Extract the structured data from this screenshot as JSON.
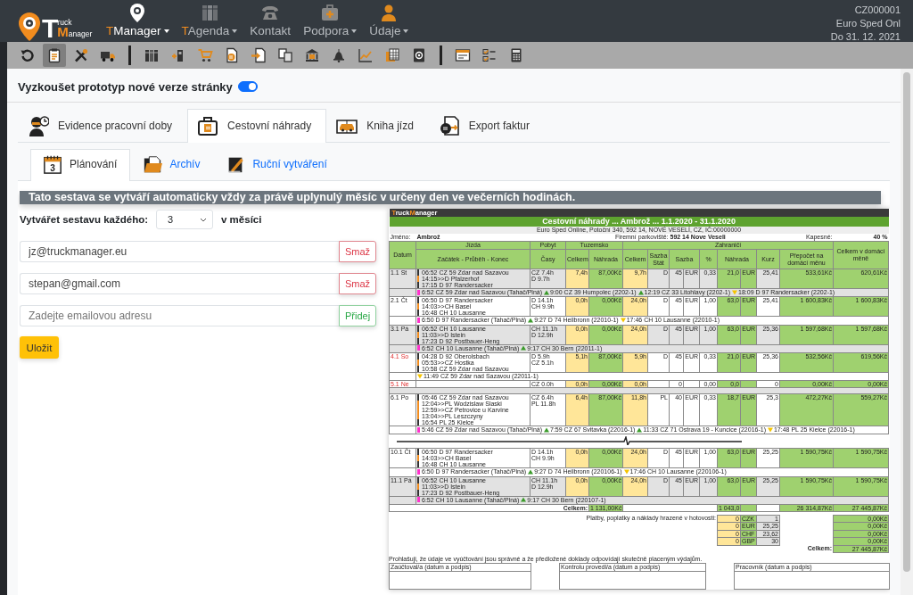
{
  "logo": {
    "big1": "T",
    "small1": "ruck",
    "big2": "M",
    "small2": "anager"
  },
  "nav": [
    {
      "label": "TManager",
      "kind": "brand",
      "selected": true,
      "dropdown": true
    },
    {
      "label": "TAgenda",
      "kind": "brand",
      "selected": false,
      "dropdown": true
    },
    {
      "label": "Kontakt",
      "kind": "plain",
      "selected": false,
      "dropdown": false
    },
    {
      "label": "Podpora",
      "kind": "plain",
      "selected": false,
      "dropdown": true
    },
    {
      "label": "Údaje",
      "kind": "plain",
      "selected": false,
      "dropdown": true
    }
  ],
  "account": [
    "CZ000001",
    "Euro Sped Onl",
    "Do 31. 12. 2021"
  ],
  "toolbar": {
    "groups": [
      [
        {
          "selected": false
        },
        {
          "selected": true
        },
        {
          "selected": false
        },
        {
          "selected": false
        }
      ],
      [
        {
          "selected": false
        },
        {
          "selected": false
        },
        {
          "selected": false
        },
        {
          "selected": false
        },
        {
          "selected": false
        },
        {
          "selected": false
        },
        {
          "selected": false
        },
        {
          "selected": false
        },
        {
          "selected": false
        },
        {
          "selected": false
        },
        {
          "selected": false
        }
      ],
      [
        {
          "selected": false
        },
        {
          "selected": false
        },
        {
          "selected": false
        }
      ]
    ]
  },
  "toggle": {
    "label": "Vyzkoušet prototyp nové verze stránky",
    "on": true
  },
  "tabs": [
    {
      "label": "Evidence pracovní doby",
      "selected": false
    },
    {
      "label": "Cestovní náhrady",
      "selected": true
    },
    {
      "label": "Kniha jízd",
      "selected": false
    },
    {
      "label": "Export faktur",
      "selected": false
    }
  ],
  "subtabs": [
    {
      "label": "Plánování",
      "selected": true,
      "icon_text": "3"
    },
    {
      "label": "Archív",
      "selected": false
    },
    {
      "label": "Ruční vytváření",
      "selected": false
    }
  ],
  "banner": "Tato sestava se vytváří automaticky vždy za právě uplynulý měsíc v určeny den ve večerních hodinách.",
  "schedule": {
    "label": "Vytvářet sestavu každého:",
    "value": "3",
    "suffix": "v měsíci"
  },
  "emails": [
    {
      "value": "jz@truckmanager.eu",
      "button": "Smaž",
      "kind": "delete"
    },
    {
      "value": "stepan@gmail.com",
      "button": "Smaž",
      "kind": "delete"
    },
    {
      "placeholder": "Zadejte emailovou adresu",
      "button": "Přidej",
      "kind": "add"
    }
  ],
  "save_button": "Uložit",
  "report": {
    "brand": [
      "Truck",
      "Manager"
    ],
    "title": "Cestovní náhrady ... Ambrož ... 1.1.2020 - 31.1.2020",
    "address": "Euro Sped Online, Potoční 340, 592 14, NOVÉ VESELÍ, CZ, IČ:00000000",
    "name_label": "Jméno:",
    "name": "Ambrož",
    "parking_label": "Firemní parkoviště:",
    "parking": "592 14 Nove Veseli",
    "pocket_label": "Kapesné:",
    "pocket": "40",
    "pocket_unit": "%",
    "header_top": [
      "Datum",
      "Jízda",
      "Pobyt",
      "Tuzemsko",
      "Zahraničí",
      "Celkem v domácí měně"
    ],
    "header_sub": [
      "Začátek - Průběh - Konec",
      "Časy",
      "Celkem",
      "Náhrada",
      "Celkem",
      "Sazba Stát",
      "Sazba",
      "%",
      "Náhrada",
      "Kurz",
      "Přepočet na domácí měnu"
    ],
    "rows": [
      {
        "date": "1.1 St",
        "weekend": false,
        "shaded": true,
        "route": [
          "06:52 CZ 59 Zdar nad Sazavou",
          "14:15>>D Pfalzerhof",
          "17:15 D 97 Randersacker"
        ],
        "stay": [
          "CZ 7.4h",
          "D 9.7h"
        ],
        "cells": [
          "7,4h",
          "87,00Kč",
          "9,7h",
          "D",
          "45",
          "EUR",
          "0,33",
          "21,0",
          "EUR",
          "25,41",
          "533,61Kč",
          "620,61Kč"
        ],
        "detail": [
          {
            "kind": "start",
            "text": "6:52 CZ 59 Zdar nad Sazavou (Tahač/Plná)"
          },
          {
            "kind": "load",
            "text": "9:00 CZ 39 Humpolec (2202-1)"
          },
          {
            "kind": "load",
            "text": "12:19 CZ 33 Litohlavy (2202-1)"
          },
          {
            "kind": "unload",
            "text": "18:09 D 97 Randersacker (2202-1)"
          }
        ]
      },
      {
        "date": "2.1 Čt",
        "weekend": false,
        "shaded": false,
        "route": [
          "06:50 D 97 Randersacker",
          "14:03>>CH Basel",
          "16:48 CH 10 Lausanne"
        ],
        "stay": [
          "D 14.1h",
          "CH 9.9h"
        ],
        "cells": [
          "0,0h",
          "0,00Kč",
          "24,0h",
          "D",
          "45",
          "EUR",
          "1,00",
          "63,0",
          "EUR",
          "25,41",
          "1 600,83Kč",
          "1 600,83Kč"
        ],
        "detail": [
          {
            "kind": "start",
            "text": "6:50 D 97 Randersacker (Tahač/Plná)"
          },
          {
            "kind": "load",
            "text": "9:27 D 74 Heilbronn (22010-1)"
          },
          {
            "kind": "unload",
            "text": "17:46 CH 10 Lausanne (22010-1)"
          }
        ]
      },
      {
        "date": "3.1 Pá",
        "weekend": false,
        "shaded": true,
        "route": [
          "06:52 CH 10 Lausanne",
          "11:03>>D Istein",
          "17:23 D 92 Postbauer-Heng"
        ],
        "stay": [
          "CH 11.1h",
          "D 12.9h"
        ],
        "cells": [
          "0,0h",
          "0,00Kč",
          "24,0h",
          "D",
          "45",
          "EUR",
          "1,00",
          "63,0",
          "EUR",
          "25,36",
          "1 597,68Kč",
          "1 597,68Kč"
        ],
        "detail": [
          {
            "kind": "start",
            "text": "6:52 CH 10 Lausanne (Tahač/Plná)"
          },
          {
            "kind": "load",
            "text": "9:17 CH 30 Bern (22011-1)"
          }
        ]
      },
      {
        "date": "4.1 So",
        "weekend": true,
        "shaded": false,
        "route": [
          "04:28 D 92 Oberolsbach",
          "05:53>>CZ Hostka",
          "10:58 CZ 59 Zdar nad Sazavou"
        ],
        "stay": [
          "D 5.9h",
          "CZ 5.1h"
        ],
        "cells": [
          "5,1h",
          "87,00Kč",
          "5,9h",
          "D",
          "45",
          "EUR",
          "0,33",
          "21,0",
          "EUR",
          "25,36",
          "532,56Kč",
          "619,56Kč"
        ],
        "detail": [
          {
            "kind": "unload",
            "text": "11:49 CZ 59 Zdar nad Sazavou (22011-1)"
          }
        ]
      },
      {
        "date": "5.1 Ne",
        "weekend": true,
        "shaded": false,
        "route": [],
        "stay": [
          "CZ 0.0h"
        ],
        "cells": [
          "0,0h",
          "0,00Kč",
          "0,0h",
          "",
          "0",
          "",
          "0,00",
          "0,0",
          "",
          "0",
          "0,00Kč",
          "0,00Kč"
        ]
      },
      {
        "date": "6.1 Po",
        "weekend": false,
        "shaded": false,
        "route": [
          "05:46 CZ 59 Zdar nad Sazavou",
          "12:04>>PL Wodzislaw Slaski",
          "12:59>>CZ Petrovice u Karvine",
          "13:04>>PL Leszczyny",
          "16:54 PL 25 Kielce"
        ],
        "stay": [
          "CZ 6.4h",
          "PL 11.8h"
        ],
        "cells": [
          "6,4h",
          "87,00Kč",
          "11,8h",
          "PL",
          "40",
          "EUR",
          "0,33",
          "18,7",
          "EUR",
          "25,3",
          "472,27Kč",
          "559,27Kč"
        ],
        "detail": [
          {
            "kind": "start",
            "text": "5:46 CZ 59 Zdar nad Sazavou (Tahač/Plná)"
          },
          {
            "kind": "load",
            "text": "7:59 CZ 67 Svitavka (22016-1)"
          },
          {
            "kind": "load",
            "text": "11:33 CZ 71 Ostrava 19 - Kuncice (22016-1)"
          },
          {
            "kind": "unload",
            "text": "17:48 PL 25 Kielce (22016-1)"
          }
        ],
        "break_after": true
      },
      {
        "date": "10.1 Čt",
        "weekend": false,
        "shaded": false,
        "route": [
          "06:50 D 97 Randersacker",
          "14:03>>CH Basel",
          "16:48 CH 10 Lausanne"
        ],
        "stay": [
          "D 14.1h",
          "CH 9.9h"
        ],
        "cells": [
          "0,0h",
          "0,00Kč",
          "24,0h",
          "D",
          "45",
          "EUR",
          "1,00",
          "63,0",
          "EUR",
          "25,25",
          "1 590,75Kč",
          "1 590,75Kč"
        ],
        "detail": [
          {
            "kind": "start",
            "text": "6:50 D 97 Randersacker (Tahač/Plná)"
          },
          {
            "kind": "load",
            "text": "9:27 D 74 Heilbronn (220106-1)"
          },
          {
            "kind": "unload",
            "text": "17:46 CH 10 Lausanne (220106-1)"
          }
        ]
      },
      {
        "date": "11.1 Pá",
        "weekend": false,
        "shaded": true,
        "route": [
          "06:52 CH 10 Lausanne",
          "11:03>>D Istein",
          "17:23 D 92 Postbauer-Heng"
        ],
        "stay": [
          "CH 11.1h",
          "D 12.9h"
        ],
        "cells": [
          "0,0h",
          "0,00Kč",
          "24,0h",
          "D",
          "45",
          "EUR",
          "1,00",
          "63,0",
          "EUR",
          "25,25",
          "1 590,75Kč",
          "1 590,75Kč"
        ],
        "detail": [
          {
            "kind": "start",
            "text": "6:52 CH 10 Lausanne (Tahač/Plná)"
          },
          {
            "kind": "load",
            "text": "9:17 CH 30 Bern (220107-1)"
          }
        ]
      }
    ],
    "totals": {
      "label": "Celkem:",
      "domestic": "1 131,00Kč",
      "foreign": "1 043,0",
      "converted": "26 314,87Kč",
      "total": "27 445,87Kč"
    },
    "cash": {
      "label": "Platby, poplatky a náklady hrazené v hotovosti:",
      "rows": [
        {
          "amount": "0",
          "currency": "CZK",
          "rate": "1",
          "total": "0,00Kč"
        },
        {
          "amount": "0",
          "currency": "EUR",
          "rate": "25,25",
          "total": "0,00Kč"
        },
        {
          "amount": "0",
          "currency": "CHF",
          "rate": "23,62",
          "total": "0,00Kč"
        },
        {
          "amount": "0",
          "currency": "GBP",
          "rate": "30",
          "total": "0,00Kč"
        }
      ],
      "total_label": "Celkem:",
      "total": "27 445,87Kč"
    },
    "declaration": "Prohlašuji, že údaje ve vyúčtování jsou správné a že předložené doklady odpovídají skutečně placeným výdajům.",
    "signatures": [
      "Zaúčtoval/a (datum a podpis)",
      "Kontrolu provedl/a (datum a podpis)",
      "Pracovník (datum a podpis)"
    ]
  }
}
